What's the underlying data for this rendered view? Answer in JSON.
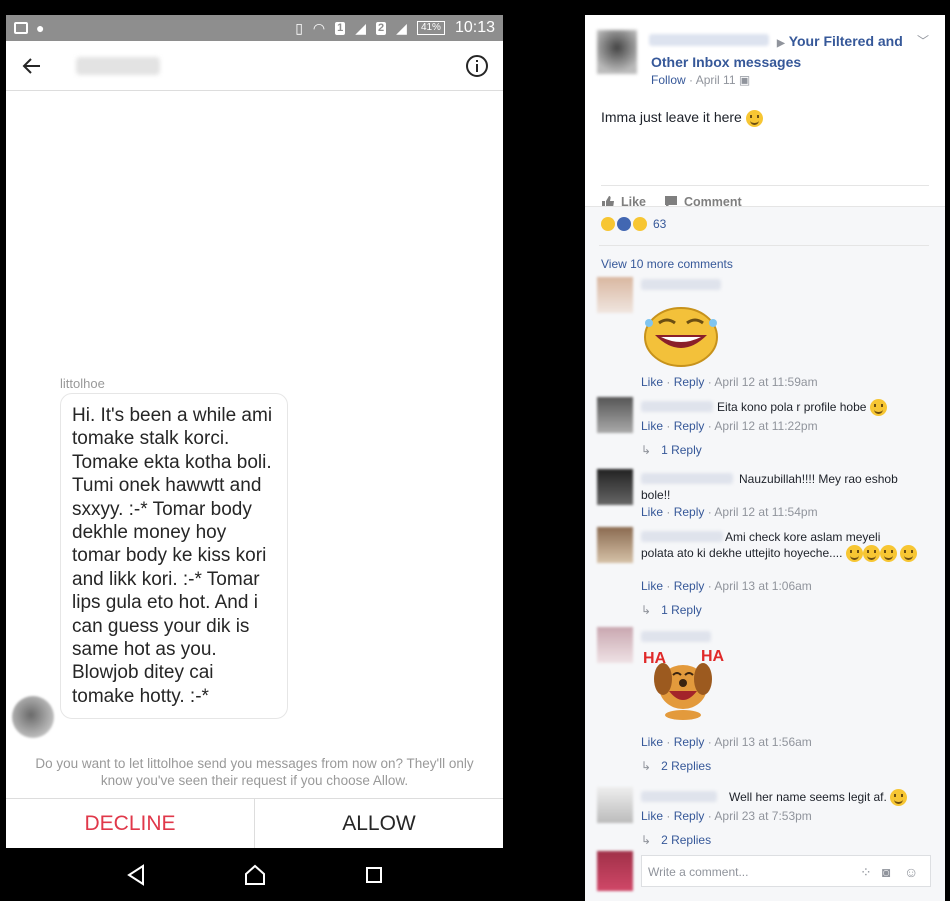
{
  "phone": {
    "status": {
      "time": "10:13",
      "battery": "41%",
      "sim1": "1",
      "sim2": "2"
    },
    "sender_label": "littolhoe",
    "message": "Hi. It's been a while ami tomake stalk korci. Tomake ekta kotha boli. Tumi onek hawwtt and sxxyy. :-* Tomar body dekhle money hoy tomar body ke kiss kori and likk kori. :-* Tomar lips gula eto hot. And i can guess your dik is same hot as you. Blowjob ditey cai tomake hotty. :-*",
    "request_text": "Do you want to let littolhoe send you messages from now on? They'll only know you've seen their request if you choose Allow.",
    "decline_label": "DECLINE",
    "allow_label": "ALLOW",
    "colors": {
      "decline": "#e0384a",
      "status_bar": "#8e8e8e"
    }
  },
  "fb": {
    "group_title": "Your Filtered and Other Inbox messages",
    "follow": "Follow",
    "date": "April 11",
    "post_text": "Imma just leave it here",
    "like_label": "Like",
    "comment_label": "Comment",
    "reaction_count": "63",
    "view_more": "View 10 more comments",
    "like": "Like",
    "reply": "Reply",
    "sep": "·",
    "comments": [
      {
        "time": "April 12 at 11:59am"
      },
      {
        "text": "Eita kono pola r profile hobe",
        "time": "April 12 at 11:22pm",
        "replies": "1 Reply"
      },
      {
        "text_line1": "Nauzubillah!!!! Mey rao eshob",
        "text_line2": "bole!!",
        "time": "April 12 at 11:54pm"
      },
      {
        "text_line1": "Ami check kore aslam meyeli",
        "text_line2": "polata ato ki dekhe uttejito hoyeche....",
        "time": "April 13 at 1:06am",
        "replies": "1 Reply"
      },
      {
        "sticker_text_1": "HA",
        "sticker_text_2": "HA",
        "time": "April 13 at 1:56am",
        "replies": "2 Replies"
      },
      {
        "text": "Well her name seems legit af.",
        "time": "April 23 at 7:53pm",
        "replies": "2 Replies"
      }
    ],
    "write_placeholder": "Write a comment...",
    "colors": {
      "link": "#365899",
      "muted": "#90949c"
    }
  }
}
